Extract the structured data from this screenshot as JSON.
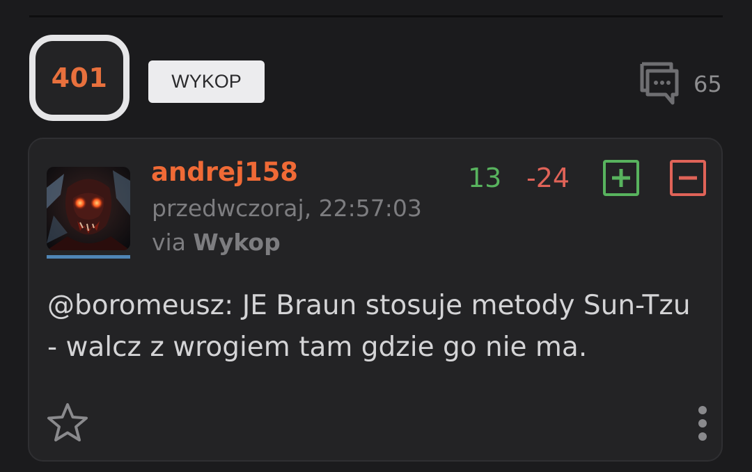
{
  "entry": {
    "votes": "401",
    "tag": "WYKOP",
    "comment_count": "65"
  },
  "comment": {
    "author": "andrej158",
    "timestamp": "przedwczoraj, 22:57:03",
    "via_prefix": "via ",
    "via_source": "Wykop",
    "plus_count": "13",
    "minus_count": "-24",
    "mention": "@boromeusz",
    "body": ": JE Braun stosuje metody Sun-Tzu - walcz z wrogiem tam gdzie go nie ma."
  },
  "icons": {
    "comments": "comments-icon",
    "plus": "plus-square-icon",
    "minus": "minus-square-icon",
    "favorite": "star-outline-icon",
    "more": "more-vertical-icon"
  },
  "colors": {
    "background": "#1b1b1d",
    "card": "#232325",
    "accent_orange": "#f06a36",
    "vote_count_orange": "#e8703d",
    "plus_green": "#58b35e",
    "minus_red": "#e06358",
    "avatar_bar_blue": "#4f85b5",
    "muted_text": "#7d7d80",
    "body_text": "#d4d4d6"
  }
}
